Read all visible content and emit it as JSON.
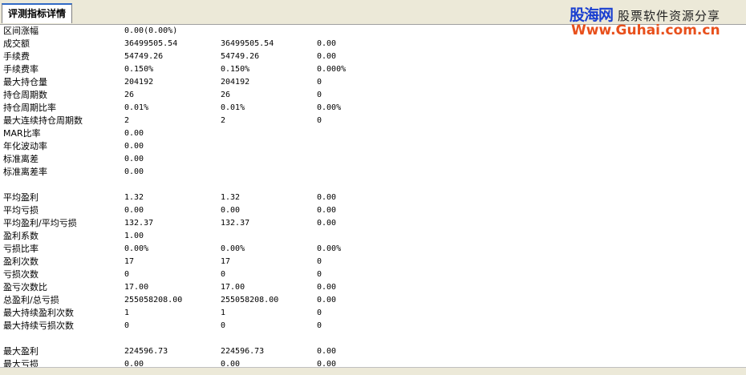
{
  "tab": {
    "label": "评测指标详情"
  },
  "watermark": {
    "brand": "股海网",
    "tagline": "股票软件资源分享",
    "url": "Www.Guhai.com.cn"
  },
  "groups": [
    {
      "rows": [
        [
          "区间涨幅",
          "0.00(0.00%)",
          "",
          ""
        ],
        [
          "成交额",
          "36499505.54",
          "36499505.54",
          "0.00"
        ],
        [
          "手续费",
          "54749.26",
          "54749.26",
          "0.00"
        ],
        [
          "手续费率",
          "0.150%",
          "0.150%",
          "0.000%"
        ],
        [
          "最大持仓量",
          "204192",
          "204192",
          "0"
        ],
        [
          "持仓周期数",
          "26",
          "26",
          "0"
        ],
        [
          "持仓周期比率",
          "0.01%",
          "0.01%",
          "0.00%"
        ],
        [
          "最大连续持仓周期数",
          "2",
          "2",
          "0"
        ],
        [
          "MAR比率",
          "0.00",
          "",
          ""
        ],
        [
          "年化波动率",
          "0.00",
          "",
          ""
        ],
        [
          "标准离差",
          "0.00",
          "",
          ""
        ],
        [
          "标准离差率",
          "0.00",
          "",
          ""
        ]
      ]
    },
    {
      "rows": [
        [
          "平均盈利",
          "1.32",
          "1.32",
          "0.00"
        ],
        [
          "平均亏损",
          "0.00",
          "0.00",
          "0.00"
        ],
        [
          "平均盈利/平均亏损",
          "132.37",
          "132.37",
          "0.00"
        ],
        [
          "盈利系数",
          "1.00",
          "",
          ""
        ],
        [
          "亏损比率",
          "0.00%",
          "0.00%",
          "0.00%"
        ],
        [
          "盈利次数",
          "17",
          "17",
          "0"
        ],
        [
          "亏损次数",
          "0",
          "0",
          "0"
        ],
        [
          "盈亏次数比",
          "17.00",
          "17.00",
          "0.00"
        ],
        [
          "总盈利/总亏损",
          "255058208.00",
          "255058208.00",
          "0.00"
        ],
        [
          "最大持续盈利次数",
          "1",
          "1",
          "0"
        ],
        [
          "最大持续亏损次数",
          "0",
          "0",
          "0"
        ]
      ]
    },
    {
      "rows": [
        [
          "最大盈利",
          "224596.73",
          "224596.73",
          "0.00"
        ],
        [
          "最大亏损",
          "0.00",
          "0.00",
          "0.00"
        ]
      ]
    }
  ]
}
